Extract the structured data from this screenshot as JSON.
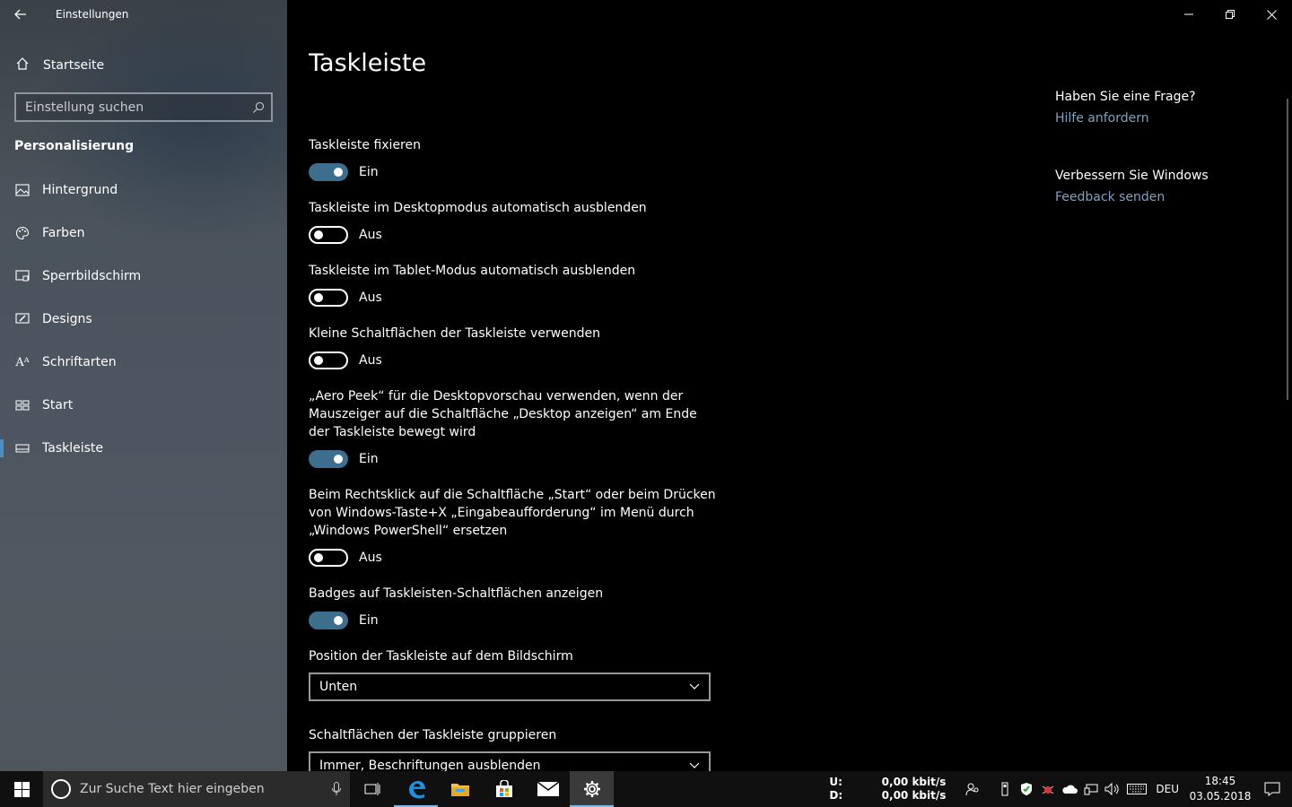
{
  "window": {
    "title": "Einstellungen"
  },
  "sidebar": {
    "home_label": "Startseite",
    "search_placeholder": "Einstellung suchen",
    "section_title": "Personalisierung",
    "items": [
      {
        "label": "Hintergrund",
        "icon": "image-icon"
      },
      {
        "label": "Farben",
        "icon": "palette-icon"
      },
      {
        "label": "Sperrbildschirm",
        "icon": "lock-screen-icon"
      },
      {
        "label": "Designs",
        "icon": "brush-icon"
      },
      {
        "label": "Schriftarten",
        "icon": "font-icon"
      },
      {
        "label": "Start",
        "icon": "start-layout-icon"
      },
      {
        "label": "Taskleiste",
        "icon": "taskbar-icon",
        "active": true
      }
    ]
  },
  "main": {
    "title": "Taskleiste",
    "settings": [
      {
        "label": "Taskleiste fixieren",
        "state": "Ein",
        "on": true
      },
      {
        "label": "Taskleiste im Desktopmodus automatisch ausblenden",
        "state": "Aus",
        "on": false
      },
      {
        "label": "Taskleiste im Tablet-Modus automatisch ausblenden",
        "state": "Aus",
        "on": false
      },
      {
        "label": "Kleine Schaltflächen der Taskleiste verwenden",
        "state": "Aus",
        "on": false
      },
      {
        "label": "„Aero Peek“ für die Desktopvorschau verwenden, wenn der Mauszeiger auf die Schaltfläche „Desktop anzeigen“ am Ende der Taskleiste bewegt wird",
        "state": "Ein",
        "on": true
      },
      {
        "label": "Beim Rechtsklick auf die Schaltfläche „Start“ oder beim Drücken von Windows-Taste+X „Eingabeaufforderung“ im Menü durch „Windows PowerShell“ ersetzen",
        "state": "Aus",
        "on": false
      },
      {
        "label": "Badges auf Taskleisten-Schaltflächen anzeigen",
        "state": "Ein",
        "on": true
      }
    ],
    "position_label": "Position der Taskleiste auf dem Bildschirm",
    "position_value": "Unten",
    "group_label": "Schaltflächen der Taskleiste gruppieren",
    "group_value": "Immer, Beschriftungen ausblenden"
  },
  "side": {
    "question": "Haben Sie eine Frage?",
    "help_link": "Hilfe anfordern",
    "improve": "Verbessern Sie Windows",
    "feedback_link": "Feedback senden"
  },
  "taskbar": {
    "search_placeholder": "Zur Suche Text hier eingeben",
    "net_up_label": "U:",
    "net_down_label": "D:",
    "net_up_value": "0,00 kbit/s",
    "net_down_value": "0,00 kbit/s",
    "language": "DEU",
    "time": "18:45",
    "date": "03.05.2018"
  },
  "colors": {
    "toggle_on": "#3d6e8e",
    "link": "#7fa2c0",
    "accent": "#4a8fc7"
  }
}
